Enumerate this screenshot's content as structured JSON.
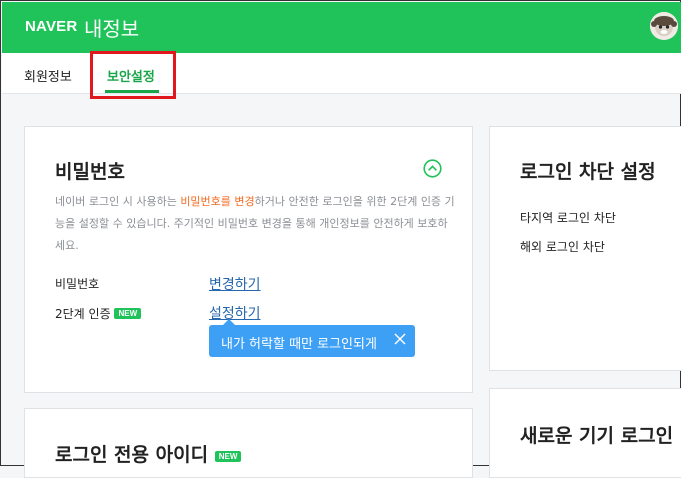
{
  "header": {
    "logo": "NAVER",
    "service": "내정보"
  },
  "tabs": [
    {
      "label": "회원정보"
    },
    {
      "label": "보안설정"
    }
  ],
  "password_card": {
    "title": "비밀번호",
    "desc_1": "네이버 로그인 시 사용하는 ",
    "desc_hl": "비밀번호를 변경",
    "desc_2": "하거나 안전한 로그인을 위한 2단계 인증 기능을 설정할 수 있습니다. 주기적인 비밀번호 변경을 통해 개인정보를 안전하게 보호하세요.",
    "rows": [
      {
        "label": "비밀번호",
        "action": "변경하기"
      },
      {
        "label": "2단계 인증",
        "badge": "NEW",
        "action": "설정하기"
      }
    ],
    "tooltip": "내가 허락할 때만 로그인되게"
  },
  "login_block_card": {
    "title": "로그인 차단 설정",
    "items": [
      "타지역 로그인 차단",
      "해외 로그인 차단"
    ]
  },
  "login_only_id_card": {
    "title": "로그인 전용 아이디",
    "badge": "NEW"
  },
  "new_device_card": {
    "title": "새로운 기기 로그인"
  },
  "colors": {
    "brand": "#1fc35a",
    "link": "#2767ae",
    "tooltip": "#3ea0f4",
    "highlight_box": "#e0181e"
  }
}
